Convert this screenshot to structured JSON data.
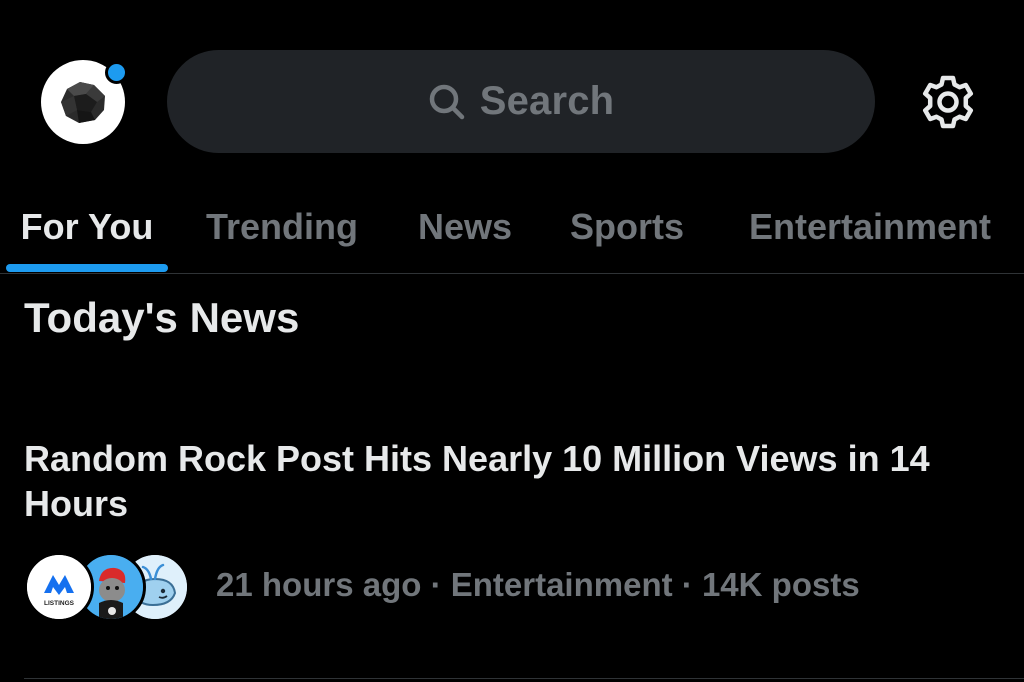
{
  "header": {
    "search_placeholder": "Search",
    "has_notification": true
  },
  "tabs": [
    {
      "label": "For You",
      "active": true
    },
    {
      "label": "Trending",
      "active": false
    },
    {
      "label": "News",
      "active": false
    },
    {
      "label": "Sports",
      "active": false
    },
    {
      "label": "Entertainment",
      "active": false
    }
  ],
  "section": {
    "title": "Today's News"
  },
  "story": {
    "headline": "Random Rock Post Hits Nearly 10 Million Views in 14 Hours",
    "time": "21 hours ago",
    "category": "Entertainment",
    "posts": "14K posts",
    "separator": "·",
    "avatars": [
      {
        "icon": "listings-logo-icon",
        "label": "LISTINGS"
      },
      {
        "icon": "cartoon-character-icon"
      },
      {
        "icon": "whale-icon"
      }
    ]
  },
  "colors": {
    "background": "#000000",
    "accent": "#1d9bf0",
    "text_primary": "#e7e9ea",
    "text_secondary": "#71767b",
    "search_bg": "#202327",
    "divider": "#2f3336"
  }
}
